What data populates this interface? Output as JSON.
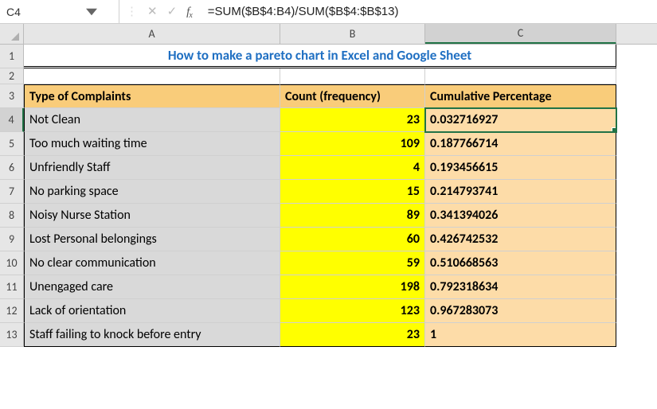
{
  "name_box": "C4",
  "formula": "=SUM($B$4:B4)/SUM($B$4:$B$13)",
  "title": "How to make a pareto chart in Excel and Google Sheet",
  "columns": {
    "A": "A",
    "B": "B",
    "C": "C"
  },
  "headers": {
    "type": "Type of Complaints",
    "count": "Count (frequency)",
    "cum": "Cumulative Percentage"
  },
  "rows": [
    {
      "n": 4,
      "type": "Not Clean",
      "count": 23,
      "cum": "0.032716927"
    },
    {
      "n": 5,
      "type": "Too much waiting time",
      "count": 109,
      "cum": "0.187766714"
    },
    {
      "n": 6,
      "type": "Unfriendly Staff",
      "count": 4,
      "cum": "0.193456615"
    },
    {
      "n": 7,
      "type": "No parking space",
      "count": 15,
      "cum": "0.214793741"
    },
    {
      "n": 8,
      "type": "Noisy Nurse Station",
      "count": 89,
      "cum": "0.341394026"
    },
    {
      "n": 9,
      "type": "Lost Personal belongings",
      "count": 60,
      "cum": "0.426742532"
    },
    {
      "n": 10,
      "type": "No clear communication",
      "count": 59,
      "cum": "0.510668563"
    },
    {
      "n": 11,
      "type": "Unengaged care",
      "count": 198,
      "cum": "0.792318634"
    },
    {
      "n": 12,
      "type": "Lack of orientation",
      "count": 123,
      "cum": "0.967283073"
    },
    {
      "n": 13,
      "type": "Staff failing to knock before entry",
      "count": 23,
      "cum": "1"
    }
  ],
  "chart_data": {
    "type": "table",
    "title": "How to make a pareto chart in Excel and Google Sheet",
    "columns": [
      "Type of Complaints",
      "Count (frequency)",
      "Cumulative Percentage"
    ],
    "series": [
      {
        "name": "Count (frequency)",
        "values": [
          23,
          109,
          4,
          15,
          89,
          60,
          59,
          198,
          123,
          23
        ]
      },
      {
        "name": "Cumulative Percentage",
        "values": [
          0.032716927,
          0.187766714,
          0.193456615,
          0.214793741,
          0.341394026,
          0.426742532,
          0.510668563,
          0.792318634,
          0.967283073,
          1
        ]
      }
    ],
    "categories": [
      "Not Clean",
      "Too much waiting time",
      "Unfriendly Staff",
      "No parking space",
      "Noisy Nurse Station",
      "Lost Personal belongings",
      "No clear communication",
      "Unengaged care",
      "Lack of orientation",
      "Staff failing to knock before entry"
    ]
  }
}
